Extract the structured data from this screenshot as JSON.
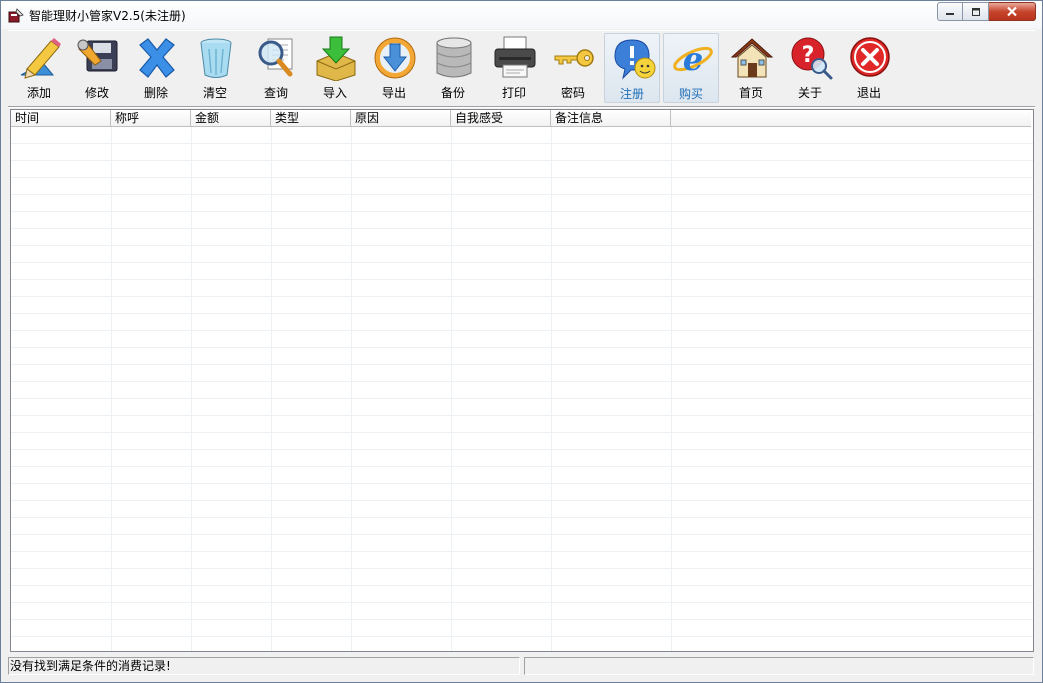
{
  "window": {
    "title": "智能理财小管家V2.5(未注册)"
  },
  "toolbar": {
    "buttons": [
      {
        "label": "添加",
        "icon": "pencil-icon"
      },
      {
        "label": "修改",
        "icon": "edit-disk-icon"
      },
      {
        "label": "删除",
        "icon": "delete-x-icon"
      },
      {
        "label": "清空",
        "icon": "trash-icon"
      },
      {
        "label": "查询",
        "icon": "magnifier-icon"
      },
      {
        "label": "导入",
        "icon": "import-icon"
      },
      {
        "label": "导出",
        "icon": "export-icon"
      },
      {
        "label": "备份",
        "icon": "database-icon"
      },
      {
        "label": "打印",
        "icon": "printer-icon"
      },
      {
        "label": "密码",
        "icon": "key-icon"
      },
      {
        "label": "注册",
        "icon": "register-icon"
      },
      {
        "label": "购买",
        "icon": "ie-icon"
      },
      {
        "label": "首页",
        "icon": "home-icon"
      },
      {
        "label": "关于",
        "icon": "help-icon"
      },
      {
        "label": "退出",
        "icon": "exit-icon"
      }
    ]
  },
  "table": {
    "columns": [
      "时间",
      "称呼",
      "金额",
      "类型",
      "原因",
      "自我感受",
      "备注信息"
    ]
  },
  "status": {
    "message": "没有找到满足条件的消费记录!"
  },
  "colors": {
    "window_bg": "#f0f0f0",
    "highlight_label": "#1f6fb8",
    "close_button": "#c7452d"
  }
}
